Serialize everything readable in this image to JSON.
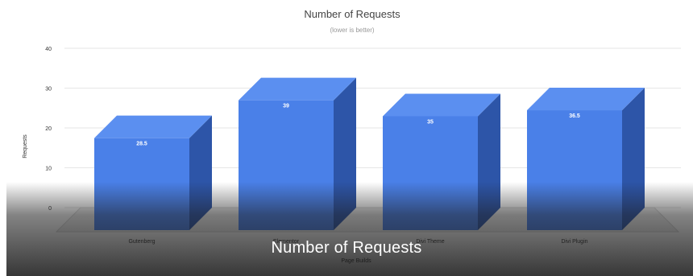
{
  "chart_data": {
    "type": "bar",
    "title": "Number of Requests",
    "subtitle": "(lower is better)",
    "xlabel": "Page Builds",
    "ylabel": "Requests",
    "categories": [
      "Gutenberg",
      "Elementor",
      "Divi Theme",
      "Divi Plugin"
    ],
    "values": [
      23.5,
      33,
      29,
      30.5
    ],
    "value_labels": [
      "28.5",
      "39",
      "35",
      "36.5"
    ],
    "yticks": [
      0,
      10,
      20,
      30,
      40
    ],
    "ylim": [
      0,
      40
    ],
    "grid": true,
    "style": "3d",
    "colors": {
      "front": "#4a80e8",
      "top": "#5b8ff0",
      "side": "#2d55a8"
    }
  },
  "overlay": {
    "caption": "Number of Requests"
  }
}
